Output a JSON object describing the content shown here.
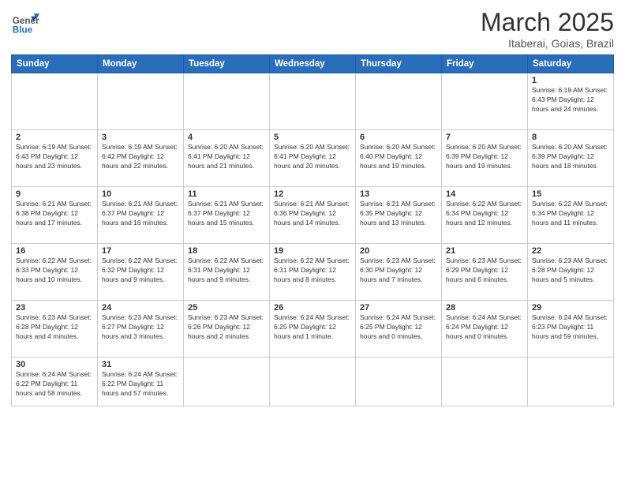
{
  "logo": {
    "general": "General",
    "blue": "Blue"
  },
  "header": {
    "title": "March 2025",
    "subtitle": "Itaberai, Goias, Brazil"
  },
  "days_of_week": [
    "Sunday",
    "Monday",
    "Tuesday",
    "Wednesday",
    "Thursday",
    "Friday",
    "Saturday"
  ],
  "weeks": [
    [
      {
        "day": "",
        "info": ""
      },
      {
        "day": "",
        "info": ""
      },
      {
        "day": "",
        "info": ""
      },
      {
        "day": "",
        "info": ""
      },
      {
        "day": "",
        "info": ""
      },
      {
        "day": "",
        "info": ""
      },
      {
        "day": "1",
        "info": "Sunrise: 6:19 AM\nSunset: 6:43 PM\nDaylight: 12 hours and 24 minutes."
      }
    ],
    [
      {
        "day": "2",
        "info": "Sunrise: 6:19 AM\nSunset: 6:43 PM\nDaylight: 12 hours and 23 minutes."
      },
      {
        "day": "3",
        "info": "Sunrise: 6:19 AM\nSunset: 6:42 PM\nDaylight: 12 hours and 22 minutes."
      },
      {
        "day": "4",
        "info": "Sunrise: 6:20 AM\nSunset: 6:41 PM\nDaylight: 12 hours and 21 minutes."
      },
      {
        "day": "5",
        "info": "Sunrise: 6:20 AM\nSunset: 6:41 PM\nDaylight: 12 hours and 20 minutes."
      },
      {
        "day": "6",
        "info": "Sunrise: 6:20 AM\nSunset: 6:40 PM\nDaylight: 12 hours and 19 minutes."
      },
      {
        "day": "7",
        "info": "Sunrise: 6:20 AM\nSunset: 6:39 PM\nDaylight: 12 hours and 19 minutes."
      },
      {
        "day": "8",
        "info": "Sunrise: 6:20 AM\nSunset: 6:39 PM\nDaylight: 12 hours and 18 minutes."
      }
    ],
    [
      {
        "day": "9",
        "info": "Sunrise: 6:21 AM\nSunset: 6:38 PM\nDaylight: 12 hours and 17 minutes."
      },
      {
        "day": "10",
        "info": "Sunrise: 6:21 AM\nSunset: 6:37 PM\nDaylight: 12 hours and 16 minutes."
      },
      {
        "day": "11",
        "info": "Sunrise: 6:21 AM\nSunset: 6:37 PM\nDaylight: 12 hours and 15 minutes."
      },
      {
        "day": "12",
        "info": "Sunrise: 6:21 AM\nSunset: 6:36 PM\nDaylight: 12 hours and 14 minutes."
      },
      {
        "day": "13",
        "info": "Sunrise: 6:21 AM\nSunset: 6:35 PM\nDaylight: 12 hours and 13 minutes."
      },
      {
        "day": "14",
        "info": "Sunrise: 6:22 AM\nSunset: 6:34 PM\nDaylight: 12 hours and 12 minutes."
      },
      {
        "day": "15",
        "info": "Sunrise: 6:22 AM\nSunset: 6:34 PM\nDaylight: 12 hours and 11 minutes."
      }
    ],
    [
      {
        "day": "16",
        "info": "Sunrise: 6:22 AM\nSunset: 6:33 PM\nDaylight: 12 hours and 10 minutes."
      },
      {
        "day": "17",
        "info": "Sunrise: 6:22 AM\nSunset: 6:32 PM\nDaylight: 12 hours and 9 minutes."
      },
      {
        "day": "18",
        "info": "Sunrise: 6:22 AM\nSunset: 6:31 PM\nDaylight: 12 hours and 9 minutes."
      },
      {
        "day": "19",
        "info": "Sunrise: 6:22 AM\nSunset: 6:31 PM\nDaylight: 12 hours and 8 minutes."
      },
      {
        "day": "20",
        "info": "Sunrise: 6:23 AM\nSunset: 6:30 PM\nDaylight: 12 hours and 7 minutes."
      },
      {
        "day": "21",
        "info": "Sunrise: 6:23 AM\nSunset: 6:29 PM\nDaylight: 12 hours and 6 minutes."
      },
      {
        "day": "22",
        "info": "Sunrise: 6:23 AM\nSunset: 6:28 PM\nDaylight: 12 hours and 5 minutes."
      }
    ],
    [
      {
        "day": "23",
        "info": "Sunrise: 6:23 AM\nSunset: 6:28 PM\nDaylight: 12 hours and 4 minutes."
      },
      {
        "day": "24",
        "info": "Sunrise: 6:23 AM\nSunset: 6:27 PM\nDaylight: 12 hours and 3 minutes."
      },
      {
        "day": "25",
        "info": "Sunrise: 6:23 AM\nSunset: 6:26 PM\nDaylight: 12 hours and 2 minutes."
      },
      {
        "day": "26",
        "info": "Sunrise: 6:24 AM\nSunset: 6:25 PM\nDaylight: 12 hours and 1 minute."
      },
      {
        "day": "27",
        "info": "Sunrise: 6:24 AM\nSunset: 6:25 PM\nDaylight: 12 hours and 0 minutes."
      },
      {
        "day": "28",
        "info": "Sunrise: 6:24 AM\nSunset: 6:24 PM\nDaylight: 12 hours and 0 minutes."
      },
      {
        "day": "29",
        "info": "Sunrise: 6:24 AM\nSunset: 6:23 PM\nDaylight: 11 hours and 59 minutes."
      }
    ],
    [
      {
        "day": "30",
        "info": "Sunrise: 6:24 AM\nSunset: 6:22 PM\nDaylight: 11 hours and 58 minutes."
      },
      {
        "day": "31",
        "info": "Sunrise: 6:24 AM\nSunset: 6:22 PM\nDaylight: 11 hours and 57 minutes."
      },
      {
        "day": "",
        "info": ""
      },
      {
        "day": "",
        "info": ""
      },
      {
        "day": "",
        "info": ""
      },
      {
        "day": "",
        "info": ""
      },
      {
        "day": "",
        "info": ""
      }
    ]
  ]
}
